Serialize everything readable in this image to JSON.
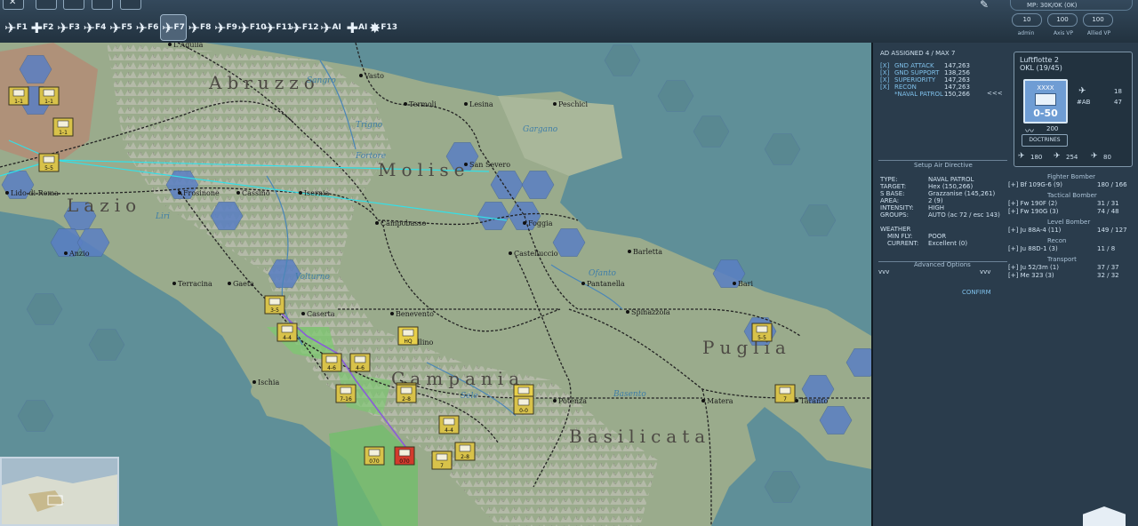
{
  "toolbar": {
    "tool_labels": [
      "F1",
      "F2",
      "F3",
      "F4",
      "F5",
      "F6",
      "F7",
      "F8",
      "F9",
      "F10",
      "F11",
      "F12",
      "AI",
      "AI",
      "F13"
    ]
  },
  "status": {
    "mp": "MP: 30K/0K (0K)",
    "admin_value": "10",
    "admin_label": "admin",
    "axis_value": "100",
    "axis_label": "Axis VP",
    "allied_value": "100",
    "allied_label": "Allied VP"
  },
  "map": {
    "regions": [
      "Abruzzo",
      "Molise",
      "Lazio",
      "Campania",
      "Puglia",
      "Basilicata"
    ],
    "cities": [
      "L'Aquila",
      "Vasto",
      "Termoli",
      "Lesina",
      "Peschici",
      "San Severo",
      "Lido di Roma",
      "Frosinone",
      "Cassino",
      "Isernia",
      "Campobasso",
      "Foggia",
      "Anzio",
      "Castelluccio",
      "Barletta",
      "Bari",
      "Terracina",
      "Gaeta",
      "Pantanella",
      "Caserta",
      "Benevento",
      "Avellino",
      "Spinazzola",
      "Ischia",
      "Potenza",
      "Matera",
      "Taranto"
    ],
    "waters": [
      "Sangro",
      "Trigno",
      "Fortore",
      "Gargano",
      "Liri",
      "Volturno",
      "Ofanto",
      "Sele",
      "Basento"
    ],
    "counters": [
      "1-1",
      "1-1",
      "1-1",
      "5-5",
      "4-4",
      "2-8",
      "4-6",
      "7-16",
      "4-6",
      "3-5",
      "HQ",
      "HQ",
      "0-0",
      "2-8",
      "070",
      "070",
      "7",
      "2-8",
      "4-4",
      "5-5",
      "7"
    ]
  },
  "air": {
    "assigned": "AD ASSIGNED 4 / MAX 7",
    "missions": [
      {
        "name": "GND ATTACK",
        "value": "147,263"
      },
      {
        "name": "GND SUPPORT",
        "value": "138,256"
      },
      {
        "name": "SUPERIORITY",
        "value": "147,263"
      },
      {
        "name": "RECON",
        "value": "147,263"
      },
      {
        "name": "*NAVAL PATROL",
        "value": "150,266"
      }
    ],
    "collapse": "<<<",
    "setup_title": "Setup Air Directive",
    "details": [
      {
        "k": "TYPE:",
        "v": "NAVAL PATROL"
      },
      {
        "k": "TARGET:",
        "v": "Hex (150,266)"
      },
      {
        "k": "S BASE:",
        "v": "Grazzanise (145,261)"
      },
      {
        "k": "AREA:",
        "v": "2 (9)"
      },
      {
        "k": "INTENSITY:",
        "v": "HIGH"
      },
      {
        "k": "GROUPS:",
        "v": "AUTO (ac 72 / esc 143)"
      }
    ],
    "weather_title": "WEATHER",
    "weather": [
      {
        "k": "MIN FLY:",
        "v": "POOR"
      },
      {
        "k": "CURRENT:",
        "v": "Excellent (0)"
      }
    ],
    "advanced": "Advanced Options",
    "adv_left": "vvv",
    "adv_right": "vvv",
    "confirm": "CONFIRM"
  },
  "unit": {
    "name": "Luftflotte 2",
    "sub": "OKL  (19/45)",
    "counter_top": "XXXX",
    "counter_strength": "0-50",
    "fighters": "18",
    "ab_label": "#AB",
    "ab_value": "47",
    "range": "200",
    "doctrines": "DOCTRINES",
    "stat1": "180",
    "stat2": "254",
    "stat3": "80"
  },
  "aircraft": {
    "sections": [
      {
        "title": "Fighter Bomber",
        "rows": [
          {
            "name": "Bf 109G-6 (9)",
            "val": "180 / 166"
          }
        ]
      },
      {
        "title": "Tactical Bomber",
        "rows": [
          {
            "name": "Fw 190F (2)",
            "val": "31 / 31"
          },
          {
            "name": "Fw 190G (3)",
            "val": "74 / 48"
          }
        ]
      },
      {
        "title": "Level Bomber",
        "rows": [
          {
            "name": "Ju 88A-4 (11)",
            "val": "149 / 127"
          }
        ]
      },
      {
        "title": "Recon",
        "rows": [
          {
            "name": "Ju 88D-1 (3)",
            "val": "11 / 8"
          }
        ]
      },
      {
        "title": "Transport",
        "rows": [
          {
            "name": "Ju 52/3m (1)",
            "val": "37 / 37"
          },
          {
            "name": "Me 323 (3)",
            "val": "32 / 32"
          }
        ]
      }
    ]
  },
  "colors": {
    "allied_hex": "#5a7fc4",
    "axis_counter": "#d8c24a",
    "air_line": "#33e0e8",
    "land": "#9aab8c",
    "sea": "#5f8f98"
  }
}
